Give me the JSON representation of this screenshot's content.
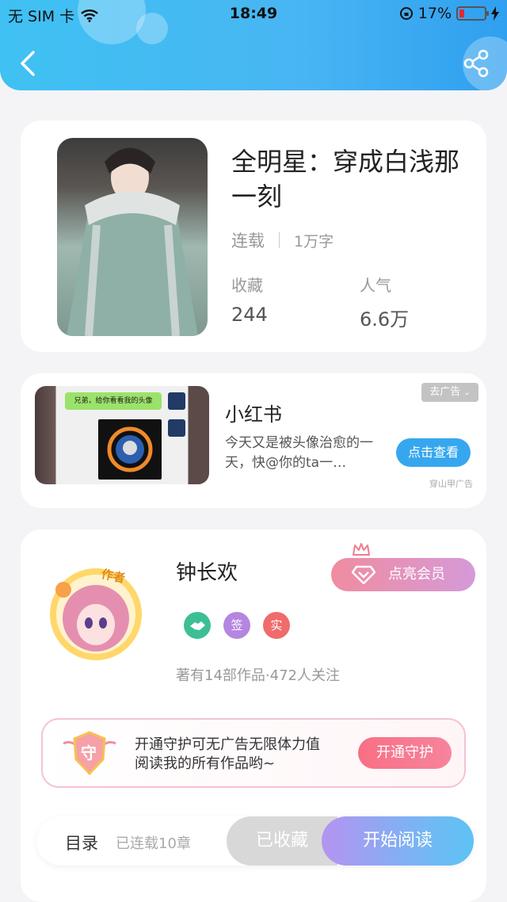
{
  "status_bar": {
    "carrier": "无 SIM 卡",
    "time": "18:49",
    "battery": "17%"
  },
  "book": {
    "title": "全明星：穿成白浅那一刻",
    "status": "连载",
    "word_count": "1万字",
    "favorites_label": "收藏",
    "favorites_value": "244",
    "popularity_label": "人气",
    "popularity_value": "6.6万"
  },
  "ad": {
    "image_text": "兄弟，给你看看我的头像",
    "title": "小红书",
    "description": "今天又是被头像治愈的一天，快@你的ta一…",
    "button": "点击查看",
    "remove_tag": "去广告",
    "source": "穿山甲广告"
  },
  "author": {
    "avatar_tag": "作者",
    "name": "钟长欢",
    "vip_button": "点亮会员",
    "badges": [
      "签",
      "实"
    ],
    "works_info": "著有14部作品·472人关注",
    "guard_badge": "守",
    "guard_text_line1": "开通守护可无广告无限体力值",
    "guard_text_line2": "阅读我的所有作品哟~",
    "guard_button": "开通守护"
  },
  "bottom": {
    "toc": "目录",
    "chapters": "已连载10章",
    "favorited": "已收藏",
    "start_reading": "开始阅读"
  },
  "colors": {
    "header": "#48b5f2",
    "read_button": "#73b8f4",
    "guard_button": "#f86f85",
    "badge_green": "#3dbf95",
    "badge_purple": "#b486e0",
    "badge_red": "#f06b6b"
  }
}
